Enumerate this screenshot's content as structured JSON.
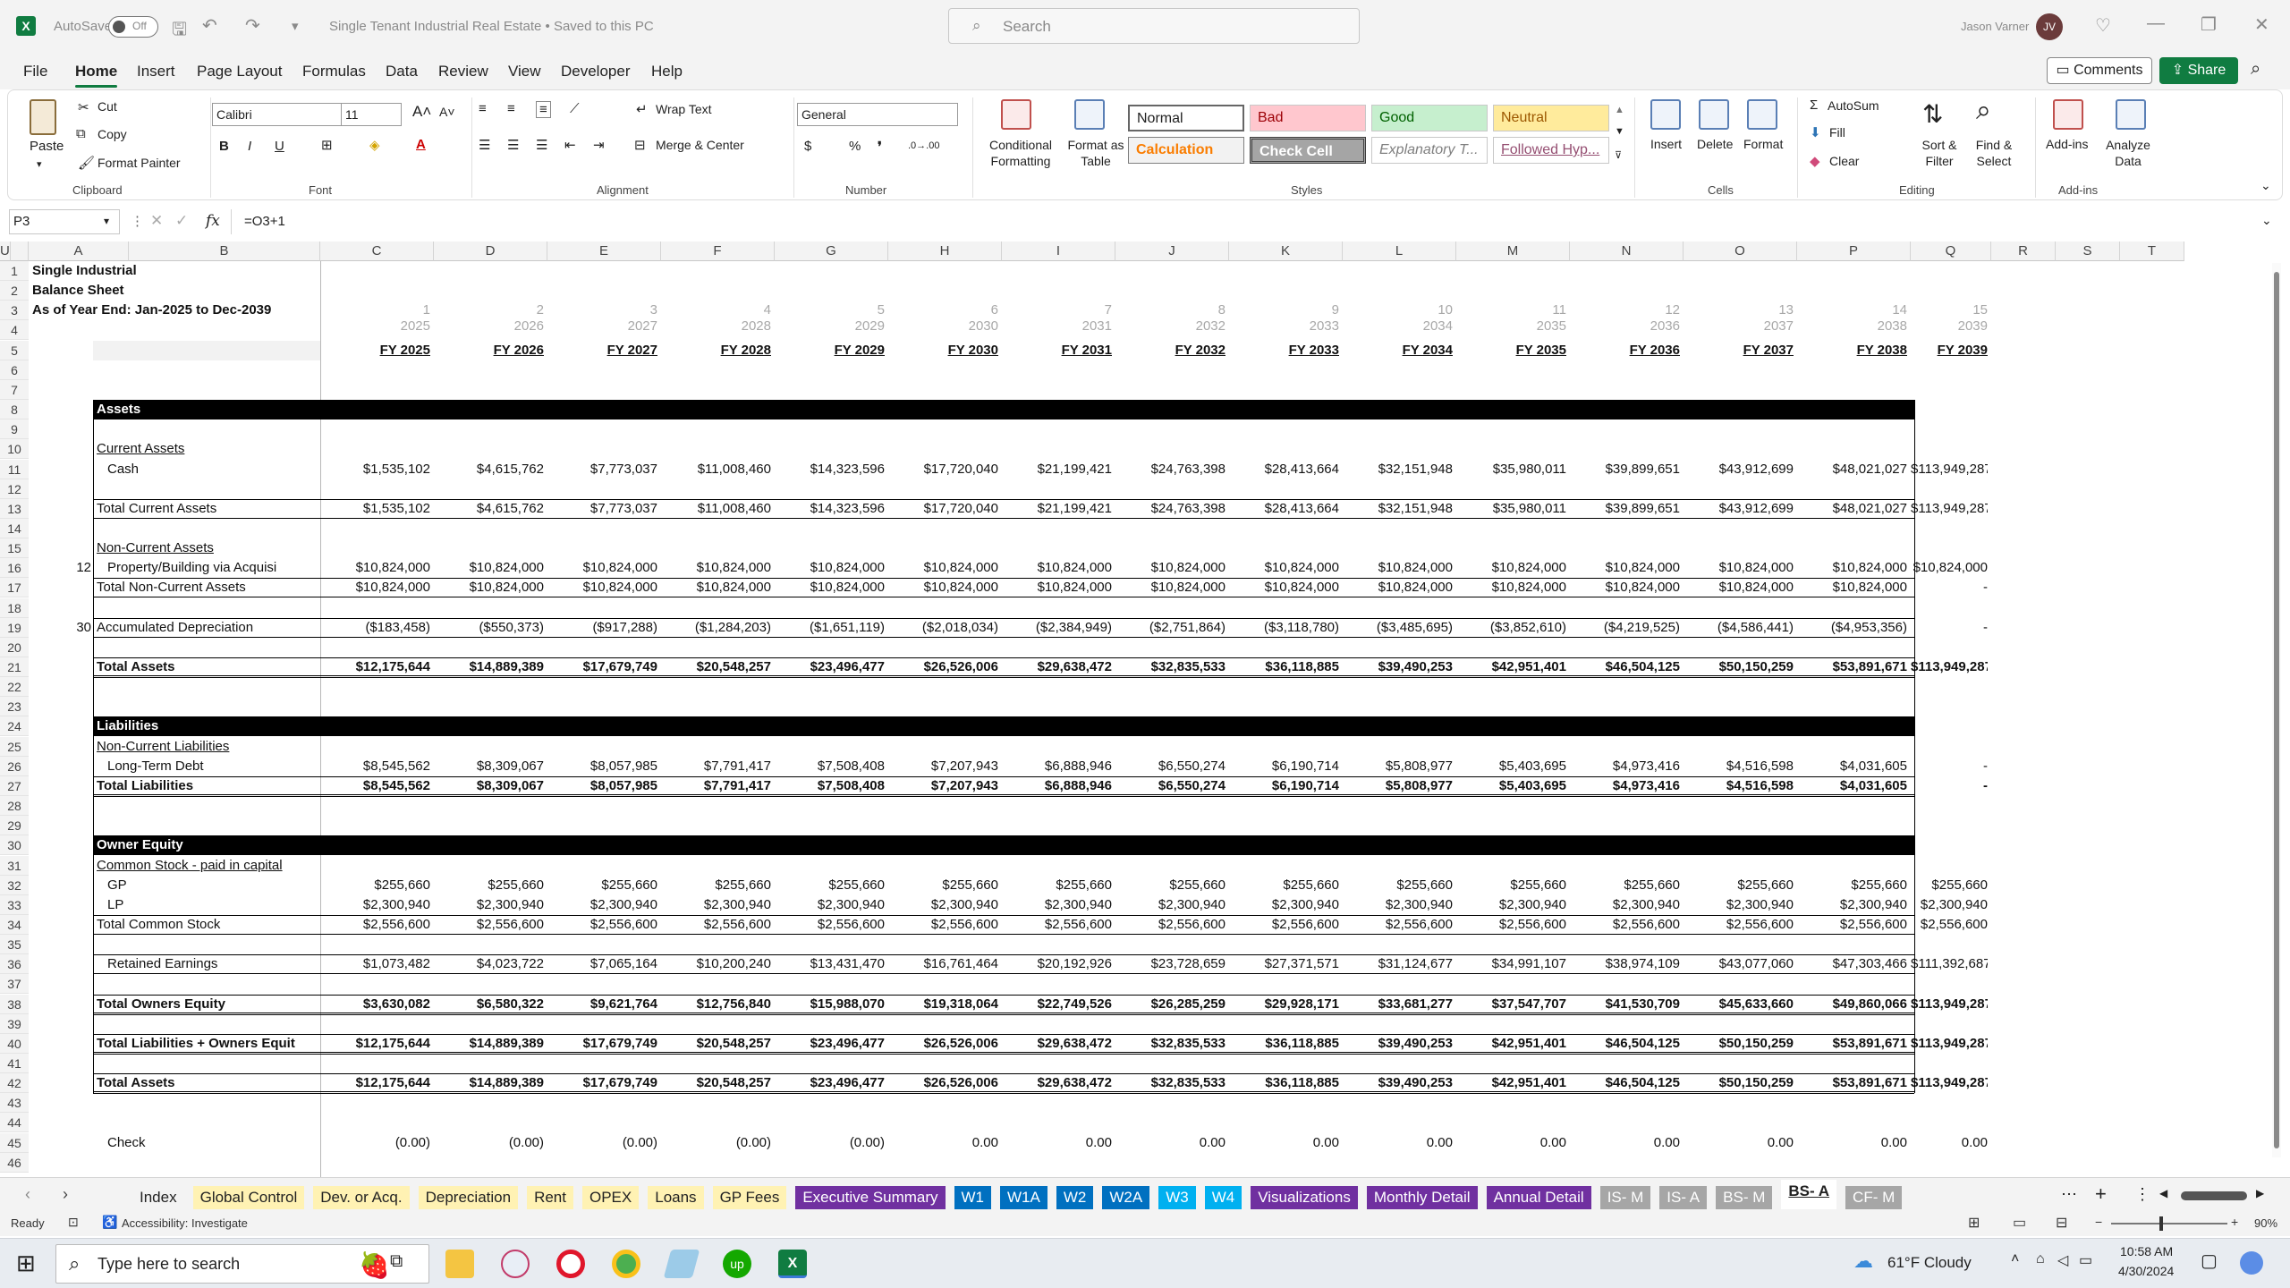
{
  "titlebar": {
    "autosave": "AutoSave",
    "toggle": "Off",
    "doc_title": "Single Tenant Industrial Real Estate • Saved to this PC",
    "search_placeholder": "Search",
    "user": "Jason Varner",
    "initials": "JV"
  },
  "menu": {
    "items": [
      "File",
      "Home",
      "Insert",
      "Page Layout",
      "Formulas",
      "Data",
      "Review",
      "View",
      "Developer",
      "Help"
    ],
    "active": "Home",
    "comments": "Comments",
    "share": "Share"
  },
  "ribbon": {
    "clipboard": {
      "paste": "Paste",
      "cut": "Cut",
      "copy": "Copy",
      "format_painter": "Format Painter",
      "group": "Clipboard"
    },
    "font": {
      "name": "Calibri",
      "size": "11",
      "group": "Font"
    },
    "alignment": {
      "wrap": "Wrap Text",
      "merge": "Merge & Center",
      "group": "Alignment"
    },
    "number": {
      "format": "General",
      "group": "Number"
    },
    "styles": {
      "cond": "Conditional Formatting",
      "format_table": "Format as Table",
      "normal": "Normal",
      "bad": "Bad",
      "good": "Good",
      "neutral": "Neutral",
      "calculation": "Calculation",
      "check": "Check Cell",
      "explanatory": "Explanatory T...",
      "followed": "Followed Hyp...",
      "group": "Styles"
    },
    "cells": {
      "insert": "Insert",
      "delete": "Delete",
      "format": "Format",
      "group": "Cells"
    },
    "editing": {
      "autosum": "AutoSum",
      "fill": "Fill",
      "clear": "Clear",
      "sort": "Sort & Filter",
      "find": "Find & Select",
      "group": "Editing"
    },
    "addins": {
      "addins": "Add-ins",
      "analyze": "Analyze Data",
      "group": "Add-ins"
    }
  },
  "formula": {
    "cell": "P3",
    "content": "=O3+1",
    "fx": "fx"
  },
  "columns": [
    "A",
    "B",
    "C",
    "D",
    "E",
    "F",
    "G",
    "H",
    "I",
    "J",
    "K",
    "L",
    "M",
    "N",
    "O",
    "P",
    "Q",
    "R",
    "S",
    "T",
    "U"
  ],
  "header_block": {
    "title1": "Single Industrial",
    "title2": "Balance Sheet",
    "title3": "As of Year End: Jan-2025 to Dec-2039",
    "period_nums": [
      "1",
      "2",
      "3",
      "4",
      "5",
      "6",
      "7",
      "8",
      "9",
      "10",
      "11",
      "12",
      "13",
      "14",
      "15"
    ],
    "years": [
      "2025",
      "2026",
      "2027",
      "2028",
      "2029",
      "2030",
      "2031",
      "2032",
      "2033",
      "2034",
      "2035",
      "2036",
      "2037",
      "2038",
      "2039"
    ],
    "fy": [
      "FY 2025",
      "FY 2026",
      "FY 2027",
      "FY 2028",
      "FY 2029",
      "FY 2030",
      "FY 2031",
      "FY 2032",
      "FY 2033",
      "FY 2034",
      "FY 2035",
      "FY 2036",
      "FY 2037",
      "FY 2038",
      "FY 2039"
    ]
  },
  "rows": [
    {
      "row": 8,
      "label": "Assets",
      "style": "black",
      "values": []
    },
    {
      "row": 10,
      "label": "Current Assets",
      "style": "u",
      "values": []
    },
    {
      "row": 11,
      "label": "Cash",
      "indent": true,
      "values": [
        "$1,535,102",
        "$4,615,762",
        "$7,773,037",
        "$11,008,460",
        "$14,323,596",
        "$17,720,040",
        "$21,199,421",
        "$24,763,398",
        "$28,413,664",
        "$32,151,948",
        "$35,980,011",
        "$39,899,651",
        "$43,912,699",
        "$48,021,027",
        "$113,949,287"
      ]
    },
    {
      "row": 13,
      "label": "Total Current Assets",
      "style": "total",
      "values": [
        "$1,535,102",
        "$4,615,762",
        "$7,773,037",
        "$11,008,460",
        "$14,323,596",
        "$17,720,040",
        "$21,199,421",
        "$24,763,398",
        "$28,413,664",
        "$32,151,948",
        "$35,980,011",
        "$39,899,651",
        "$43,912,699",
        "$48,021,027",
        "$113,949,287"
      ]
    },
    {
      "row": 15,
      "label": "Non-Current Assets",
      "style": "u",
      "values": []
    },
    {
      "row": 16,
      "a": "12",
      "label": "Property/Building via Acquisi",
      "indent": true,
      "values": [
        "$10,824,000",
        "$10,824,000",
        "$10,824,000",
        "$10,824,000",
        "$10,824,000",
        "$10,824,000",
        "$10,824,000",
        "$10,824,000",
        "$10,824,000",
        "$10,824,000",
        "$10,824,000",
        "$10,824,000",
        "$10,824,000",
        "$10,824,000",
        "$10,824,000"
      ]
    },
    {
      "row": 17,
      "label": "Total Non-Current Assets",
      "style": "total",
      "values": [
        "$10,824,000",
        "$10,824,000",
        "$10,824,000",
        "$10,824,000",
        "$10,824,000",
        "$10,824,000",
        "$10,824,000",
        "$10,824,000",
        "$10,824,000",
        "$10,824,000",
        "$10,824,000",
        "$10,824,000",
        "$10,824,000",
        "$10,824,000",
        "-"
      ]
    },
    {
      "row": 19,
      "a": "30",
      "label": "Accumulated Depreciation",
      "style": "box",
      "values": [
        "($183,458)",
        "($550,373)",
        "($917,288)",
        "($1,284,203)",
        "($1,651,119)",
        "($2,018,034)",
        "($2,384,949)",
        "($2,751,864)",
        "($3,118,780)",
        "($3,485,695)",
        "($3,852,610)",
        "($4,219,525)",
        "($4,586,441)",
        "($4,953,356)",
        "-"
      ]
    },
    {
      "row": 21,
      "label": "Total Assets",
      "style": "bold",
      "values": [
        "$12,175,644",
        "$14,889,389",
        "$17,679,749",
        "$20,548,257",
        "$23,496,477",
        "$26,526,006",
        "$29,638,472",
        "$32,835,533",
        "$36,118,885",
        "$39,490,253",
        "$42,951,401",
        "$46,504,125",
        "$50,150,259",
        "$53,891,671",
        "$113,949,287"
      ]
    },
    {
      "row": 24,
      "label": "Liabilities",
      "style": "black",
      "values": []
    },
    {
      "row": 25,
      "label": "Non-Current Liabilities",
      "style": "u",
      "values": []
    },
    {
      "row": 26,
      "label": "Long-Term Debt",
      "indent": true,
      "values": [
        "$8,545,562",
        "$8,309,067",
        "$8,057,985",
        "$7,791,417",
        "$7,508,408",
        "$7,207,943",
        "$6,888,946",
        "$6,550,274",
        "$6,190,714",
        "$5,808,977",
        "$5,403,695",
        "$4,973,416",
        "$4,516,598",
        "$4,031,605",
        "-"
      ]
    },
    {
      "row": 27,
      "label": "Total Liabilities",
      "style": "bold",
      "values": [
        "$8,545,562",
        "$8,309,067",
        "$8,057,985",
        "$7,791,417",
        "$7,508,408",
        "$7,207,943",
        "$6,888,946",
        "$6,550,274",
        "$6,190,714",
        "$5,808,977",
        "$5,403,695",
        "$4,973,416",
        "$4,516,598",
        "$4,031,605",
        "-"
      ]
    },
    {
      "row": 30,
      "label": "Owner Equity",
      "style": "black",
      "values": []
    },
    {
      "row": 31,
      "label": "Common Stock - paid in capital",
      "style": "u",
      "values": []
    },
    {
      "row": 32,
      "label": "GP",
      "indent": true,
      "values": [
        "$255,660",
        "$255,660",
        "$255,660",
        "$255,660",
        "$255,660",
        "$255,660",
        "$255,660",
        "$255,660",
        "$255,660",
        "$255,660",
        "$255,660",
        "$255,660",
        "$255,660",
        "$255,660",
        "$255,660"
      ]
    },
    {
      "row": 33,
      "label": "LP",
      "indent": true,
      "values": [
        "$2,300,940",
        "$2,300,940",
        "$2,300,940",
        "$2,300,940",
        "$2,300,940",
        "$2,300,940",
        "$2,300,940",
        "$2,300,940",
        "$2,300,940",
        "$2,300,940",
        "$2,300,940",
        "$2,300,940",
        "$2,300,940",
        "$2,300,940",
        "$2,300,940"
      ]
    },
    {
      "row": 34,
      "label": "Total Common Stock",
      "style": "total",
      "values": [
        "$2,556,600",
        "$2,556,600",
        "$2,556,600",
        "$2,556,600",
        "$2,556,600",
        "$2,556,600",
        "$2,556,600",
        "$2,556,600",
        "$2,556,600",
        "$2,556,600",
        "$2,556,600",
        "$2,556,600",
        "$2,556,600",
        "$2,556,600",
        "$2,556,600"
      ]
    },
    {
      "row": 36,
      "label": "Retained Earnings",
      "indent": true,
      "style": "box",
      "values": [
        "$1,073,482",
        "$4,023,722",
        "$7,065,164",
        "$10,200,240",
        "$13,431,470",
        "$16,761,464",
        "$20,192,926",
        "$23,728,659",
        "$27,371,571",
        "$31,124,677",
        "$34,991,107",
        "$38,974,109",
        "$43,077,060",
        "$47,303,466",
        "$111,392,687"
      ]
    },
    {
      "row": 38,
      "label": "Total Owners Equity",
      "style": "bold",
      "values": [
        "$3,630,082",
        "$6,580,322",
        "$9,621,764",
        "$12,756,840",
        "$15,988,070",
        "$19,318,064",
        "$22,749,526",
        "$26,285,259",
        "$29,928,171",
        "$33,681,277",
        "$37,547,707",
        "$41,530,709",
        "$45,633,660",
        "$49,860,066",
        "$113,949,287"
      ]
    },
    {
      "row": 40,
      "label": "Total Liabilities + Owners Equit",
      "style": "bold",
      "values": [
        "$12,175,644",
        "$14,889,389",
        "$17,679,749",
        "$20,548,257",
        "$23,496,477",
        "$26,526,006",
        "$29,638,472",
        "$32,835,533",
        "$36,118,885",
        "$39,490,253",
        "$42,951,401",
        "$46,504,125",
        "$50,150,259",
        "$53,891,671",
        "$113,949,287"
      ]
    },
    {
      "row": 42,
      "label": "Total Assets",
      "style": "bold",
      "values": [
        "$12,175,644",
        "$14,889,389",
        "$17,679,749",
        "$20,548,257",
        "$23,496,477",
        "$26,526,006",
        "$29,638,472",
        "$32,835,533",
        "$36,118,885",
        "$39,490,253",
        "$42,951,401",
        "$46,504,125",
        "$50,150,259",
        "$53,891,671",
        "$113,949,287"
      ]
    },
    {
      "row": 45,
      "label": "Check",
      "indent": true,
      "values": [
        "(0.00)",
        "(0.00)",
        "(0.00)",
        "(0.00)",
        "(0.00)",
        "0.00",
        "0.00",
        "0.00",
        "0.00",
        "0.00",
        "0.00",
        "0.00",
        "0.00",
        "0.00",
        "0.00"
      ]
    }
  ],
  "sheet_tabs": [
    {
      "label": "Index",
      "bg": "",
      "fg": "#222"
    },
    {
      "label": "Global Control",
      "bg": "#fff2b3",
      "fg": "#222"
    },
    {
      "label": "Dev. or Acq.",
      "bg": "#fff2b3",
      "fg": "#222"
    },
    {
      "label": "Depreciation",
      "bg": "#fff2b3",
      "fg": "#222"
    },
    {
      "label": "Rent",
      "bg": "#fff2b3",
      "fg": "#222"
    },
    {
      "label": "OPEX",
      "bg": "#fff2b3",
      "fg": "#222"
    },
    {
      "label": "Loans",
      "bg": "#fff2b3",
      "fg": "#222"
    },
    {
      "label": "GP Fees",
      "bg": "#fff2b3",
      "fg": "#222"
    },
    {
      "label": "Executive Summary",
      "bg": "#7030a0",
      "fg": "#fff"
    },
    {
      "label": "W1",
      "bg": "#0070c0",
      "fg": "#fff"
    },
    {
      "label": "W1A",
      "bg": "#0070c0",
      "fg": "#fff"
    },
    {
      "label": "W2",
      "bg": "#0070c0",
      "fg": "#fff"
    },
    {
      "label": "W2A",
      "bg": "#0070c0",
      "fg": "#fff"
    },
    {
      "label": "W3",
      "bg": "#00b0f0",
      "fg": "#fff"
    },
    {
      "label": "W4",
      "bg": "#00b0f0",
      "fg": "#fff"
    },
    {
      "label": "Visualizations",
      "bg": "#7030a0",
      "fg": "#fff"
    },
    {
      "label": "Monthly Detail",
      "bg": "#7030a0",
      "fg": "#fff"
    },
    {
      "label": "Annual Detail",
      "bg": "#7030a0",
      "fg": "#fff"
    },
    {
      "label": "IS- M",
      "bg": "#a6a6a6",
      "fg": "#fff"
    },
    {
      "label": "IS- A",
      "bg": "#a6a6a6",
      "fg": "#fff"
    },
    {
      "label": "BS- M",
      "bg": "#a6a6a6",
      "fg": "#fff"
    },
    {
      "label": "BS- A",
      "bg": "",
      "fg": "#222"
    },
    {
      "label": "CF- M",
      "bg": "#a6a6a6",
      "fg": "#fff"
    }
  ],
  "status": {
    "ready": "Ready",
    "accessibility": "Accessibility: Investigate",
    "zoom": "90%"
  },
  "taskbar": {
    "search": "Type here to search",
    "weather": "61°F  Cloudy",
    "time": "10:58 AM",
    "date": "4/30/2024"
  }
}
